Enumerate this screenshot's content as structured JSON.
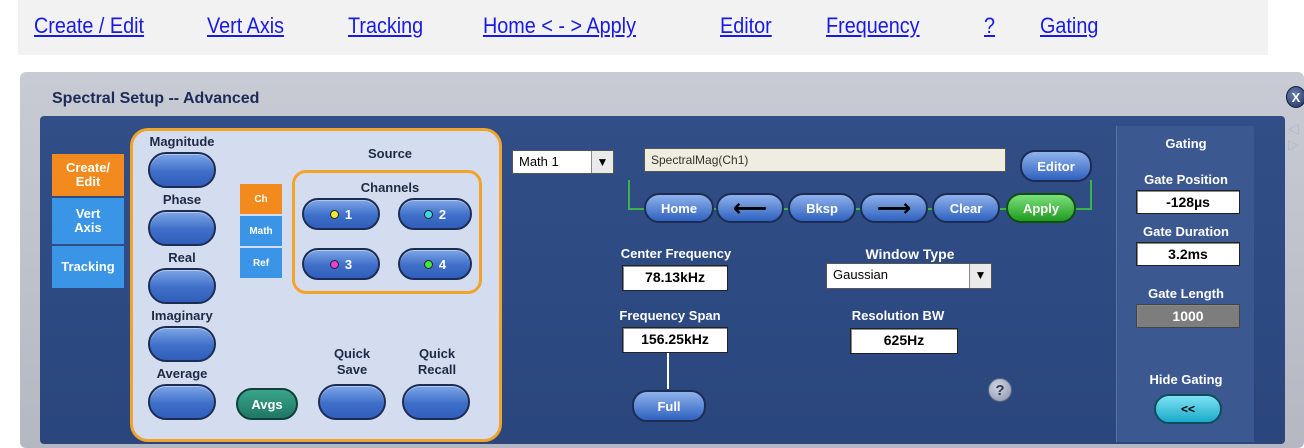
{
  "nav_links": [
    "Create / Edit",
    "Vert Axis",
    "Tracking",
    "Home < - > Apply",
    "Editor",
    "Frequency",
    "?",
    "Gating"
  ],
  "window": {
    "title": "Spectral Setup -- Advanced",
    "close_label": "X"
  },
  "left_tabs": [
    "Create/ Edit",
    "Vert Axis",
    "Tracking"
  ],
  "function_buttons": {
    "magnitude": "Magnitude",
    "phase": "Phase",
    "real": "Real",
    "imaginary": "Imaginary",
    "average": "Average"
  },
  "source": {
    "title": "Source",
    "tabs": [
      "Ch",
      "Math",
      "Ref"
    ],
    "channels_title": "Channels",
    "channels": [
      "1",
      "2",
      "3",
      "4"
    ],
    "avgs_label": "Avgs",
    "quick_save": "Quick Save",
    "quick_recall": "Quick Recall"
  },
  "math": {
    "select_value": "Math 1",
    "expression": "SpectralMag(Ch1)",
    "editor_button": "Editor",
    "buttons": {
      "home": "Home",
      "bksp": "Bksp",
      "clear": "Clear",
      "apply": "Apply"
    }
  },
  "frequency": {
    "center_label": "Center Frequency",
    "center_value": "78.13kHz",
    "span_label": "Frequency Span",
    "span_value": "156.25kHz",
    "full_label": "Full"
  },
  "window_settings": {
    "window_type_label": "Window Type",
    "window_type_value": "Gaussian",
    "res_bw_label": "Resolution BW",
    "res_bw_value": "625Hz",
    "help": "?"
  },
  "gating": {
    "title": "Gating",
    "position_label": "Gate Position",
    "position_value": "-128µs",
    "duration_label": "Gate Duration",
    "duration_value": "3.2ms",
    "length_label": "Gate Length",
    "length_value": "1000",
    "hide_label": "Hide Gating",
    "hide_button": "<<"
  },
  "colors": {
    "accent_orange": "#f2a32a",
    "panel_blue": "#2a467d",
    "apply_green": "#2ca42c"
  }
}
